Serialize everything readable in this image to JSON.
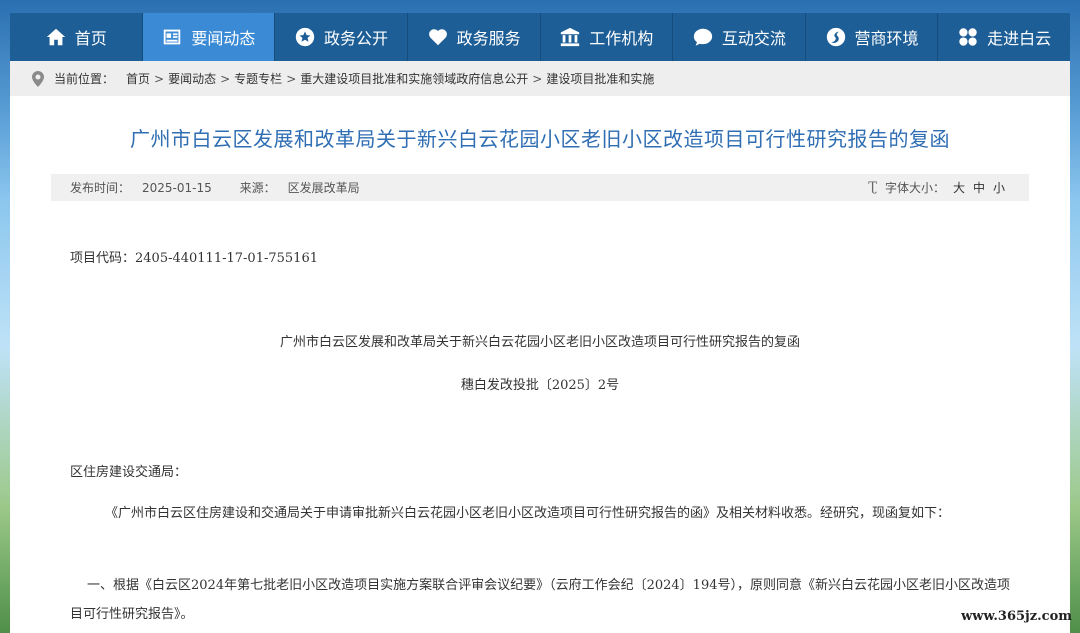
{
  "nav": {
    "items": [
      {
        "label": "首页",
        "icon": "home-icon"
      },
      {
        "label": "要闻动态",
        "icon": "news-card-icon"
      },
      {
        "label": "政务公开",
        "icon": "star-circle-icon"
      },
      {
        "label": "政务服务",
        "icon": "heart-icon"
      },
      {
        "label": "工作机构",
        "icon": "building-icon"
      },
      {
        "label": "互动交流",
        "icon": "chat-bubble-icon"
      },
      {
        "label": "营商环境",
        "icon": "business-swirl-icon"
      },
      {
        "label": "走进白云",
        "icon": "clover-icon"
      }
    ],
    "active_index": 1
  },
  "breadcrumb": {
    "prefix": "当前位置：",
    "items": [
      "首页",
      "要闻动态",
      "专题专栏",
      "重大建设项目批准和实施领域政府信息公开",
      "建设项目批准和实施"
    ],
    "separator": ">"
  },
  "article": {
    "title": "广州市白云区发展和改革局关于新兴白云花园小区老旧小区改造项目可行性研究报告的复函",
    "publish_label": "发布时间：",
    "publish_date": "2025-01-15",
    "source_label": "来源：",
    "source": "区发展改革局",
    "fontsize_label": "字体大小：",
    "fontsize_options": [
      "大",
      "中",
      "小"
    ],
    "code_line": "项目代码：2405-440111-17-01-755161",
    "doc_title": "广州市白云区发展和改革局关于新兴白云花园小区老旧小区改造项目可行性研究报告的复函",
    "doc_number": "穗白发改投批〔2025〕2号",
    "recipient": "区住房建设交通局：",
    "para1": "《广州市白云区住房建设和交通局关于申请审批新兴白云花园小区老旧小区改造项目可行性研究报告的函》及相关材料收悉。经研究，现函复如下：",
    "para2": "一、根据《白云区2024年第七批老旧小区改造项目实施方案联合评审会议纪要》（云府工作会纪〔2024〕194号），原则同意《新兴白云花园小区老旧小区改造项目可行性研究报告》。"
  },
  "watermark": "www.365jz.com",
  "colors": {
    "nav_bg": "#1e5e96",
    "nav_active": "#3a8ad6",
    "title": "#2f6eb3"
  }
}
